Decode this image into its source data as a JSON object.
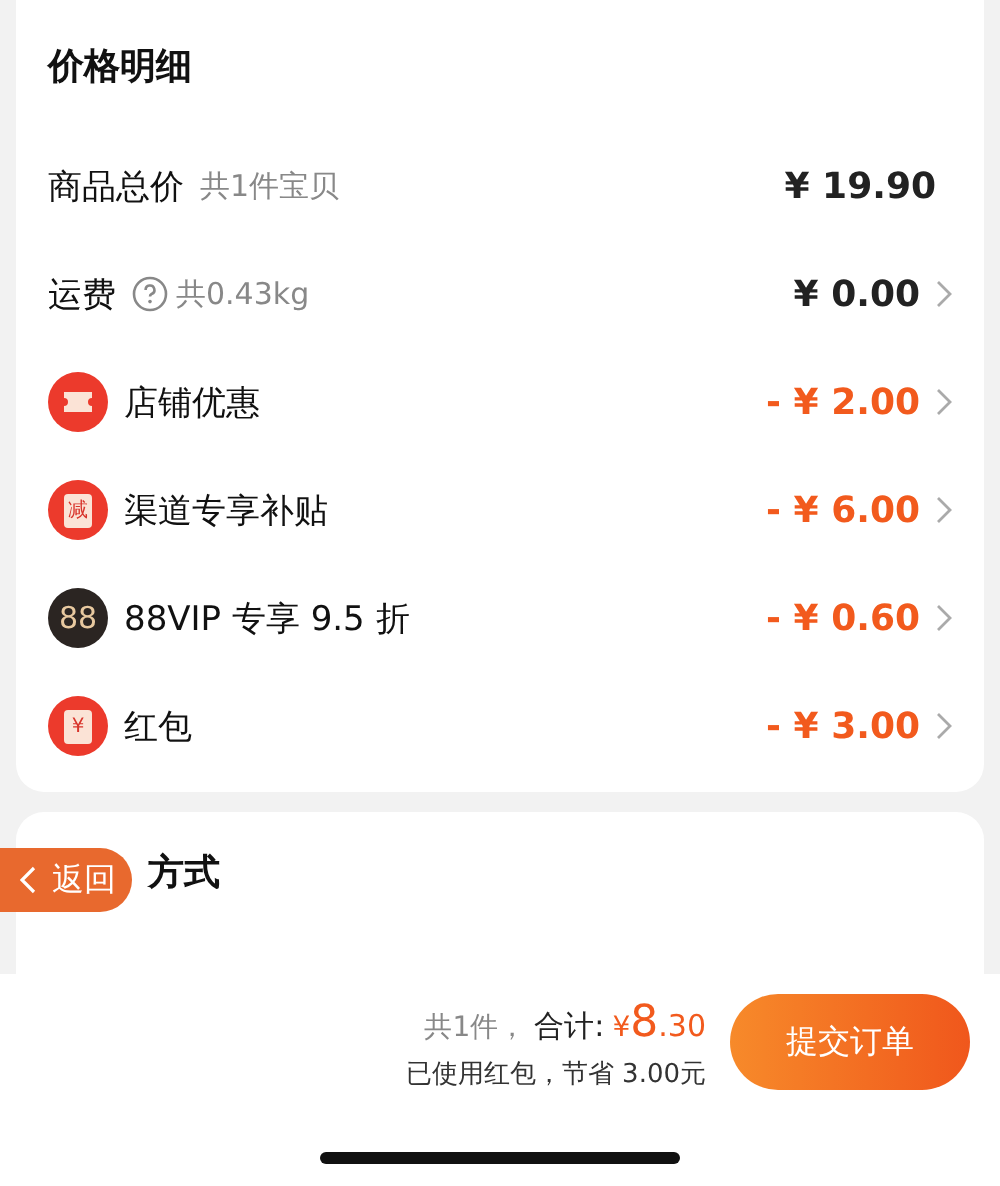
{
  "price_details": {
    "title": "价格明细",
    "rows": [
      {
        "kind": "plain",
        "label": "商品总价",
        "note": "共1件宝贝",
        "amount": "¥ 19.90",
        "chevron": false
      },
      {
        "kind": "help",
        "label": "运费",
        "note": "共0.43kg",
        "amount": "¥ 0.00",
        "chevron": true
      },
      {
        "kind": "shop_discount",
        "label": "店铺优惠",
        "amount": "- ¥ 2.00",
        "chevron": true
      },
      {
        "kind": "subsidy",
        "icon_text": "减",
        "label": "渠道专享补贴",
        "amount": "- ¥ 6.00",
        "chevron": true
      },
      {
        "kind": "vip",
        "icon_text": "88",
        "label": "88VIP 专享 9.5 折",
        "amount": "- ¥ 0.60",
        "chevron": true
      },
      {
        "kind": "red_packet",
        "icon_text": "¥",
        "label": "红包",
        "amount": "- ¥ 3.00",
        "chevron": true
      }
    ]
  },
  "payment": {
    "title": "方式"
  },
  "back_button": {
    "label": "返回"
  },
  "footer": {
    "count": "共1件，",
    "total_label": "合计:",
    "currency": "¥",
    "total_int": "8",
    "total_dec": ".30",
    "savings": "已使用红包，节省 3.00元",
    "submit": "提交订单"
  }
}
